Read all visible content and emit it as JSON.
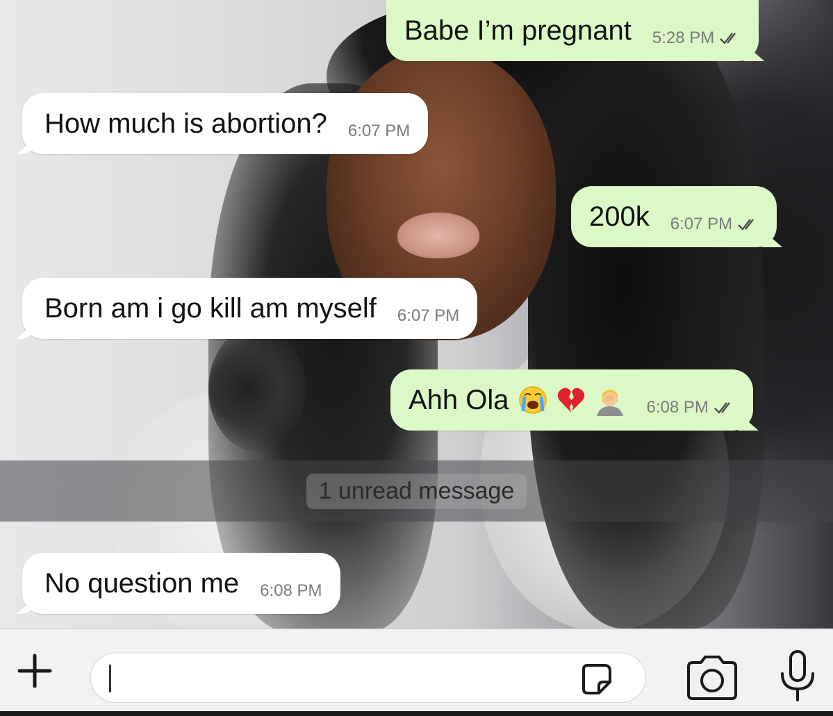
{
  "messages": [
    {
      "dir": "out",
      "text": "Babe I’m pregnant",
      "time": "5:28 PM",
      "read": true
    },
    {
      "dir": "in",
      "text": "How much is abortion?",
      "time": "6:07 PM"
    },
    {
      "dir": "out",
      "text": "200k",
      "time": "6:07 PM",
      "read": true
    },
    {
      "dir": "in",
      "text": "Born am i go kill am myself",
      "time": "6:07 PM"
    },
    {
      "dir": "out",
      "text": "Ahh Ola",
      "time": "6:08 PM",
      "read": true,
      "emojis": [
        "loudly-crying-face",
        "broken-heart",
        "person-facepalming"
      ]
    },
    {
      "dir": "in",
      "text": "No question me",
      "time": "6:08 PM"
    }
  ],
  "unread_banner": "1 unread message",
  "input": {
    "value": "",
    "icons": [
      "plus-icon",
      "sticker-icon",
      "camera-icon",
      "microphone-icon"
    ]
  },
  "colors": {
    "outgoing_bubble": "#dcf8c6",
    "incoming_bubble": "#ffffff",
    "timestamp": "#7a7a7a",
    "ticks": "#4a4a4a"
  }
}
